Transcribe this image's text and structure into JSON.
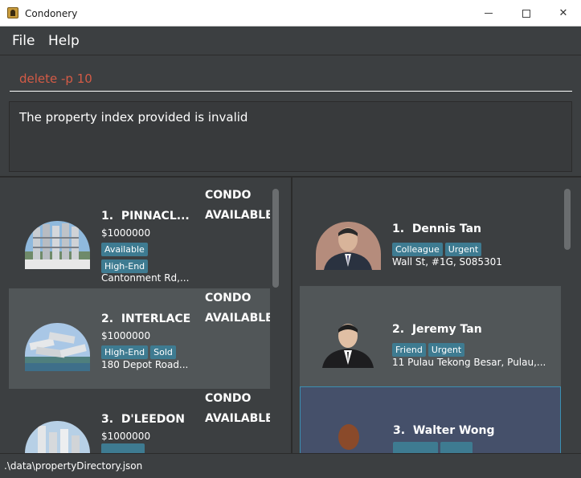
{
  "window": {
    "title": "Condonery",
    "minimize_icon": "minimize-icon",
    "maximize_icon": "maximize-icon",
    "close_icon": "close-icon"
  },
  "menu": {
    "file": "File",
    "help": "Help"
  },
  "command": {
    "value": "delete -p 10",
    "color": "#d45b46"
  },
  "result": {
    "text": "The property index provided is invalid"
  },
  "properties": [
    {
      "index": "1.",
      "name": "PINNACL...",
      "price": "$1000000",
      "tags_row1": [
        "Available"
      ],
      "tags_row2": [
        "High-End"
      ],
      "address": "Cantonment Rd,...",
      "type": "CONDO",
      "status": "AVAILABLE"
    },
    {
      "index": "2.",
      "name": "INTERLACE",
      "price": "$1000000",
      "tags_row1": [
        "High-End",
        "Sold"
      ],
      "tags_row2": [],
      "address": "180 Depot Road...",
      "type": "CONDO",
      "status": "AVAILABLE"
    },
    {
      "index": "3.",
      "name": "D'LEEDON",
      "price": "$1000000",
      "tags_row1": [],
      "tags_row2": [],
      "address": "",
      "type": "CONDO",
      "status": "AVAILABLE"
    }
  ],
  "clients": [
    {
      "index": "1.",
      "name": "Dennis Tan",
      "tags": [
        "Colleague",
        "Urgent"
      ],
      "address": "Wall St, #1G, S085301"
    },
    {
      "index": "2.",
      "name": "Jeremy Tan",
      "tags": [
        "Friend",
        "Urgent"
      ],
      "address": "11 Pulau Tekong Besar, Pulau,..."
    },
    {
      "index": "3.",
      "name": "Walter Wong",
      "tags": [],
      "address": ""
    }
  ],
  "status_bar": {
    "path": ".\\data\\propertyDirectory.json"
  },
  "colors": {
    "background": "#3c3f41",
    "tag": "#3e7b91",
    "selected_card": "#45506a",
    "selected_border": "#3b8fb2"
  }
}
